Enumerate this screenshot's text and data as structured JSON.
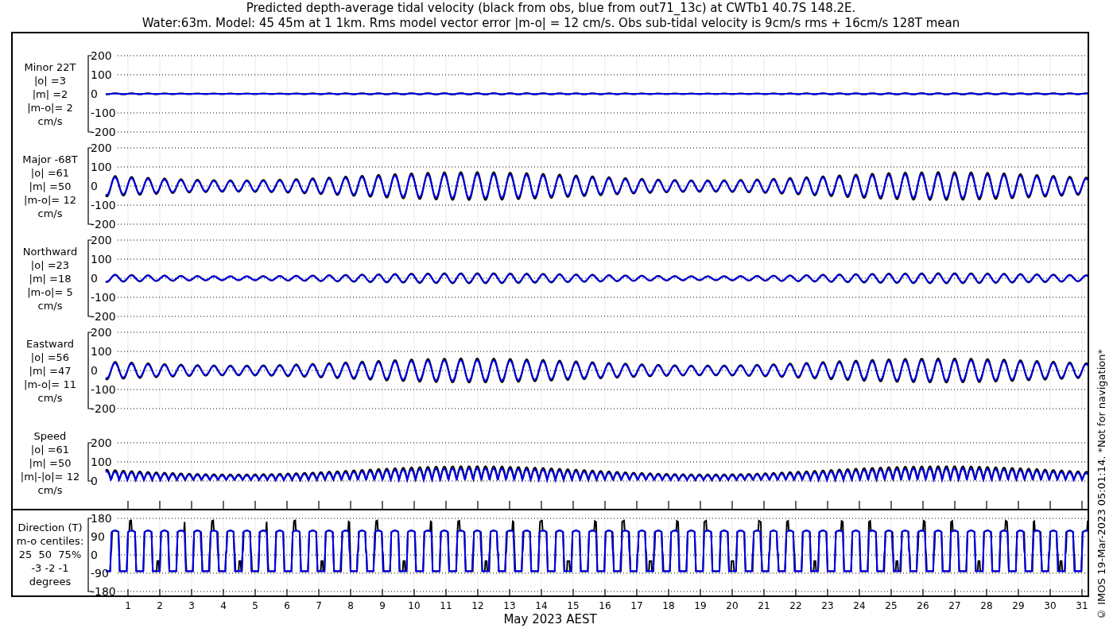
{
  "title": [
    "Predicted depth-average tidal velocity (black from obs, blue from out71_13c) at CWTb1 40.7S 148.2E.",
    "Water:63m. Model: 45 45m at 1 1km. Rms model vector error |m-o| = 12 cm/s. Obs sub-tidal velocity is 9cm/s rms + 16cm/s 128T mean"
  ],
  "panels": [
    {
      "kind": "component",
      "label": [
        "Minor 22T",
        "|o| =3",
        "|m| =2",
        "|m-o|= 2",
        "cm/s"
      ],
      "yticks": [
        "200",
        "100",
        "0",
        "-100",
        "-200"
      ]
    },
    {
      "kind": "component",
      "label": [
        "Major -68T",
        "|o| =61",
        "|m| =50",
        "|m-o|= 12",
        "cm/s"
      ],
      "yticks": [
        "200",
        "100",
        "0",
        "-100",
        "-200"
      ]
    },
    {
      "kind": "component",
      "label": [
        "Northward",
        "|o| =23",
        "|m| =18",
        "|m-o|= 5",
        "cm/s"
      ],
      "yticks": [
        "200",
        "100",
        "0",
        "-100",
        "-200"
      ]
    },
    {
      "kind": "component",
      "label": [
        "Eastward",
        "|o| =56",
        "|m| =47",
        "|m-o|= 11",
        "cm/s"
      ],
      "yticks": [
        "200",
        "100",
        "0",
        "-100",
        "-200"
      ]
    },
    {
      "kind": "speed",
      "label": [
        "Speed",
        "|o| =61",
        "|m| =50",
        "|m|-|o|= 12",
        "cm/s"
      ],
      "yticks": [
        "200",
        "100",
        "0"
      ]
    },
    {
      "kind": "direction",
      "label": [
        "Direction (T)",
        "m-o centiles:",
        "25  50  75%",
        "-3 -2 -1",
        "degrees"
      ],
      "yticks": [
        "180",
        "90",
        "0",
        "-90",
        "-180"
      ]
    }
  ],
  "xticks": [
    "1",
    "2",
    "3",
    "4",
    "5",
    "6",
    "7",
    "8",
    "9",
    "10",
    "11",
    "12",
    "13",
    "14",
    "15",
    "16",
    "17",
    "18",
    "19",
    "20",
    "21",
    "22",
    "23",
    "24",
    "25",
    "26",
    "27",
    "28",
    "29",
    "30",
    "31"
  ],
  "xlabel": "May 2023 AEST",
  "credit": "© IMOS 19-Mar-2023 05:01:14. *Not for navigation*"
}
